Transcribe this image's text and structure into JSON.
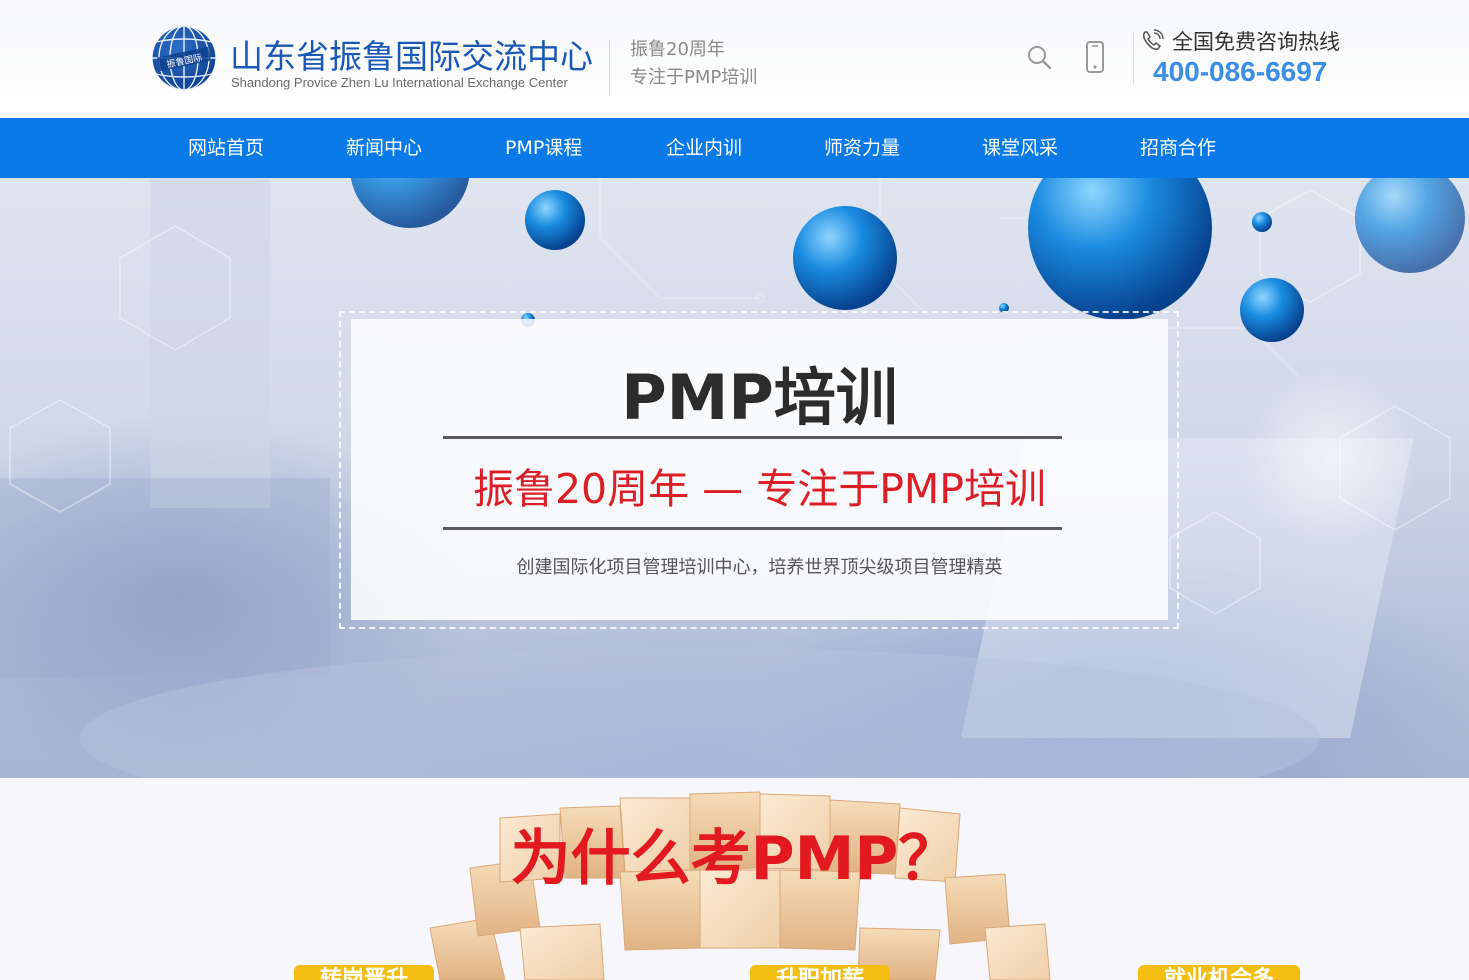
{
  "header": {
    "logo_text": "振鲁国际",
    "brand_cn": "山东省振鲁国际交流中心",
    "brand_en": "Shandong Provice Zhen Lu International Exchange Center",
    "slogan_line1": "振鲁20周年",
    "slogan_line2": "专注于PMP培训",
    "search_icon": "search-icon",
    "phone_icon": "mobile-phone-icon",
    "hotline_icon": "phone-call-icon",
    "hotline_label": "全国免费咨询热线",
    "hotline_number": "400-086-6697"
  },
  "nav": {
    "items": [
      {
        "label": "网站首页"
      },
      {
        "label": "新闻中心"
      },
      {
        "label": "PMP课程"
      },
      {
        "label": "企业内训"
      },
      {
        "label": "师资力量"
      },
      {
        "label": "课堂风采"
      },
      {
        "label": "招商合作"
      }
    ]
  },
  "banner": {
    "title": "PMP培训",
    "subtitle": "振鲁20周年 — 专注于PMP培训",
    "description": "创建国际化项目管理培训中心，培养世界顶尖级项目管理精英"
  },
  "why": {
    "title": "为什么考PMP？",
    "tags": [
      {
        "label": "转岗晋升"
      },
      {
        "label": "升职加薪"
      },
      {
        "label": "就业机会多"
      }
    ]
  },
  "colors": {
    "nav_bg": "#0a7ae9",
    "brand_blue": "#1a58b8",
    "hotline_blue": "#3a8ee8",
    "accent_red": "#e2191f",
    "tag_yellow": "#f4bd12"
  }
}
